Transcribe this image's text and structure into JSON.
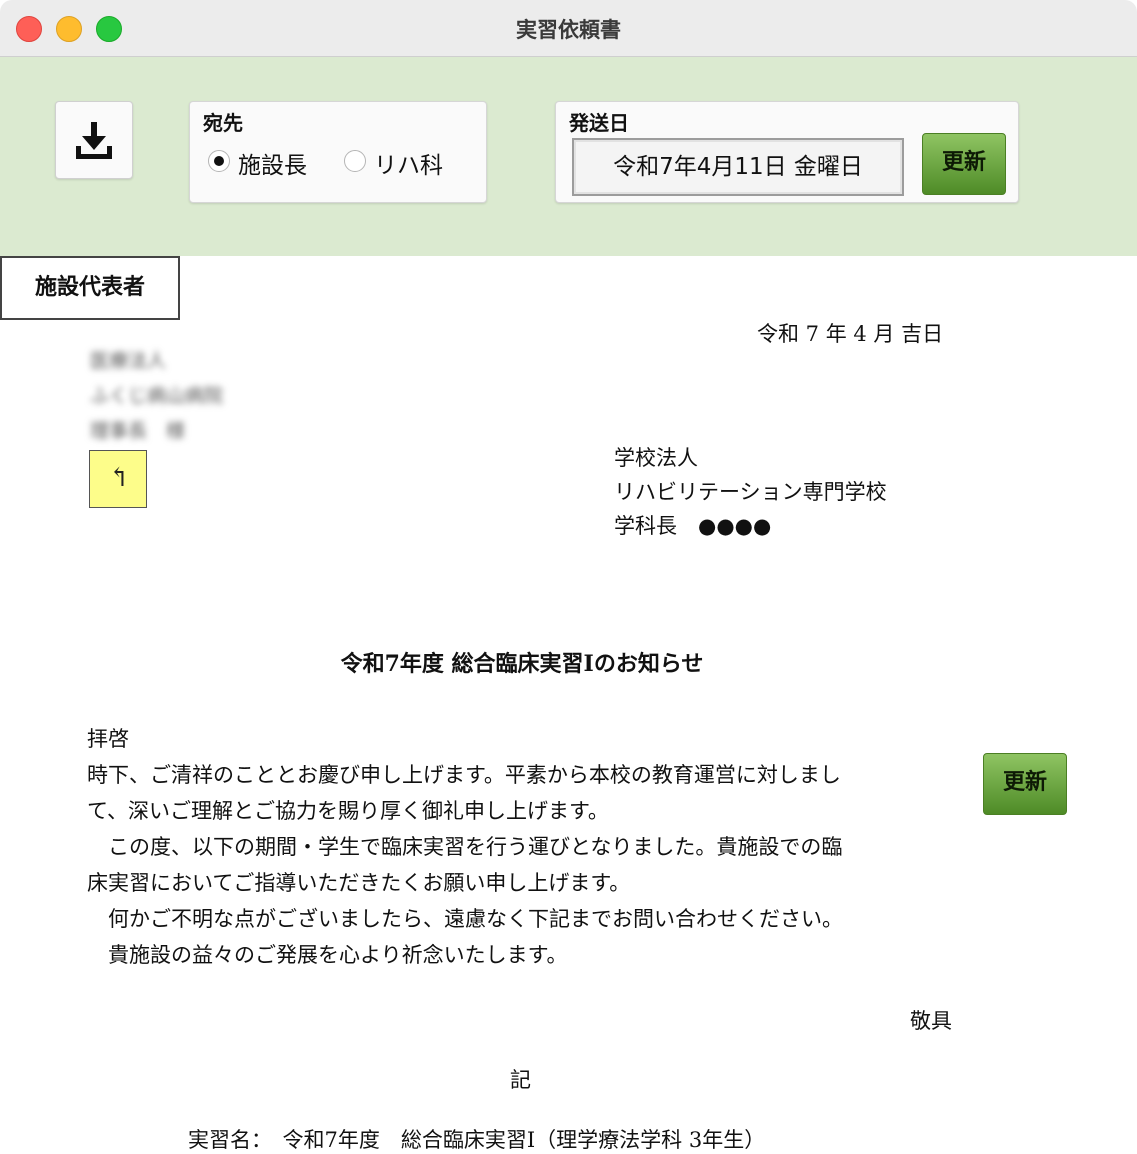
{
  "window": {
    "title": "実習依頼書"
  },
  "toolbar": {
    "recipient": {
      "label": "宛先",
      "options": [
        "施設長",
        "リハ科"
      ],
      "selected": "施設長"
    },
    "send_date": {
      "label": "発送日",
      "value": "令和7年4月11日 金曜日",
      "update_label": "更新"
    }
  },
  "tab": {
    "label": "施設代表者"
  },
  "letter": {
    "date": "令和 7 年 4 月 吉日",
    "recipient_blurred": [
      "医療法人",
      "ふくじ病山病院",
      "理事長　様"
    ],
    "sender": [
      "学校法人",
      "リハビリテーション専門学校",
      "学科長　●●●●"
    ],
    "title": "令和7年度 総合臨床実習Ⅰのお知らせ",
    "body": [
      "拝啓",
      "時下、ご清祥のこととお慶び申し上げます。平素から本校の教育運営に対しまし",
      "て、深いご理解とご協力を賜り厚く御礼申し上げます。",
      "　この度、以下の期間・学生で臨床実習を行う運びとなりました。貴施設での臨",
      "床実習においてご指導いただきたくお願い申し上げます。",
      "　何かご不明な点がございましたら、遠慮なく下記までお問い合わせください。",
      "　貴施設の益々のご発展を心より祈念いたします。"
    ],
    "closing": "敬具",
    "ki": "記",
    "practicum_line": "実習名：　令和7年度　総合臨床実習Ⅰ（理学療法学科 3年生）",
    "update_label": "更新"
  },
  "colors": {
    "toolbar_bg": "#dbead0",
    "green_button": "#5f9a35",
    "return_button": "#fdfd8a"
  },
  "icons": {
    "download": "download-icon",
    "return": "return-arrow-icon"
  }
}
